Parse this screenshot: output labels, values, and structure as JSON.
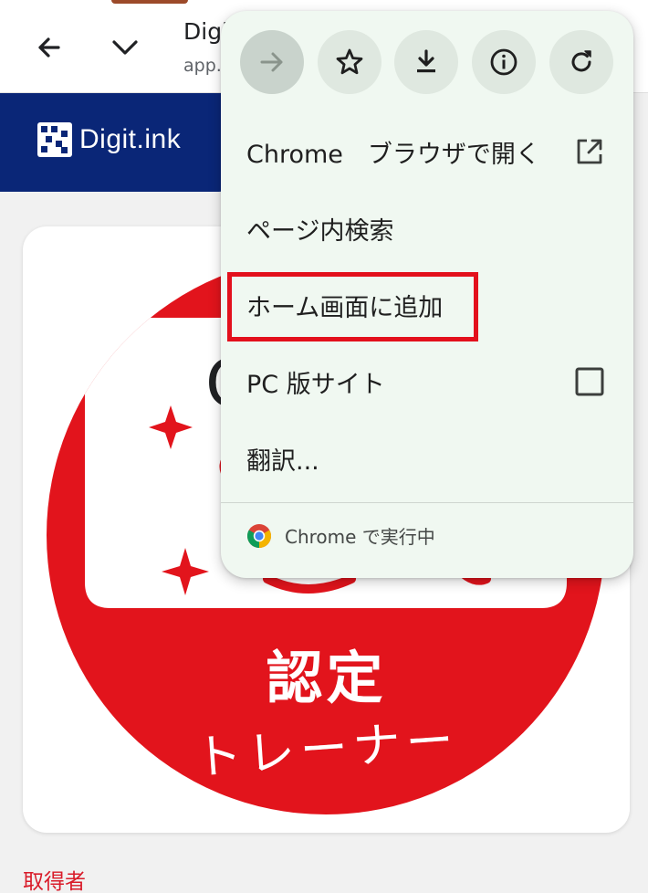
{
  "topbar": {
    "title": "Digit",
    "url": "app."
  },
  "site": {
    "logo_text": "Digit.ink"
  },
  "badge": {
    "main_text": "認定",
    "sub_text": "トレーナー",
    "partial_char": "C"
  },
  "content": {
    "holder_label": "取得者"
  },
  "menu": {
    "icons": [
      {
        "name": "forward-icon"
      },
      {
        "name": "bookmark-star-icon"
      },
      {
        "name": "download-icon"
      },
      {
        "name": "info-icon"
      },
      {
        "name": "reload-icon"
      }
    ],
    "items": [
      {
        "label": "Chrome　ブラウザで開く",
        "trailing_icon": "open-external-icon"
      },
      {
        "label": "ページ内検索"
      },
      {
        "label": "ホーム画面に追加"
      },
      {
        "label": "PC 版サイト",
        "trailing_icon": "checkbox-icon"
      },
      {
        "label": "翻訳..."
      }
    ],
    "footer": "Chrome で実行中"
  },
  "colors": {
    "header_navy": "#0a2677",
    "badge_red": "#e2141c",
    "menu_bg": "#f0f8f1",
    "highlight_red": "#e3101c",
    "holder_label_red": "#d91c2a"
  }
}
